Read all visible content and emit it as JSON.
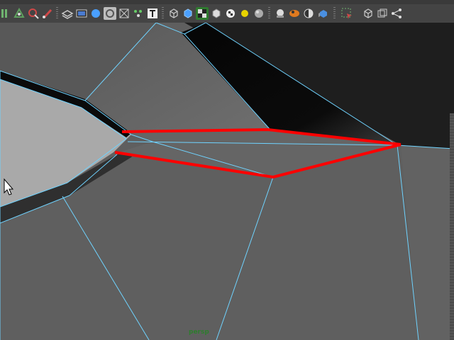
{
  "window": {
    "camera_name": "persp"
  },
  "toolbar": {
    "buttons": [
      {
        "icon": "snap-grid-icon",
        "color": "#6fb36f"
      },
      {
        "icon": "snap-vertex-icon",
        "color": "#5fa05f"
      },
      {
        "icon": "paint-select-icon",
        "color": "#d04848"
      },
      {
        "icon": "brush-icon",
        "color": "#d04848"
      },
      {
        "icon": "layer-stack-icon",
        "color": "#bbbbbb"
      },
      {
        "icon": "film-gate-icon",
        "color": "#bbbbbb"
      },
      {
        "icon": "sphere-shaded-icon",
        "color": "#4aa0ff"
      },
      {
        "icon": "circle-outline-icon",
        "color": "#bbbbbb"
      },
      {
        "icon": "grid-checker-icon",
        "color": "#bbbbbb"
      },
      {
        "icon": "vertex-dots-icon",
        "color": "#66cc66"
      },
      {
        "icon": "text-t-icon",
        "color": "#eeeeee"
      },
      {
        "icon": "cube-wireframe-icon",
        "color": "#cccccc"
      },
      {
        "icon": "cube-shaded-icon",
        "color": "#4aa0ff"
      },
      {
        "icon": "checker-texture-icon",
        "color": "#dddddd"
      },
      {
        "icon": "cube-outline-icon",
        "color": "#cccccc"
      },
      {
        "icon": "checkerboard-icon",
        "color": "#dddddd"
      },
      {
        "icon": "light-bulb-icon",
        "color": "#e8d400"
      },
      {
        "icon": "sphere-grey-icon",
        "color": "#aaaaaa"
      },
      {
        "icon": "shaded-ball-icon",
        "color": "#dddddd"
      },
      {
        "icon": "orange-ball-icon",
        "color": "#e07a1f"
      },
      {
        "icon": "half-ball-icon",
        "color": "#dddddd"
      },
      {
        "icon": "blue-cube-icon",
        "color": "#4a8fe0"
      },
      {
        "icon": "select-marquee-icon",
        "color": "#d04848"
      },
      {
        "icon": "cube-view-icon",
        "color": "#cccccc"
      },
      {
        "icon": "isolate-panels-icon",
        "color": "#cccccc"
      },
      {
        "icon": "share-nodes-icon",
        "color": "#dddddd"
      }
    ]
  },
  "scene": {
    "background_color": "#5f5f5f",
    "edge_color": "#6fd3ff",
    "highlight_color": "#ff0000",
    "selection_label": ""
  }
}
